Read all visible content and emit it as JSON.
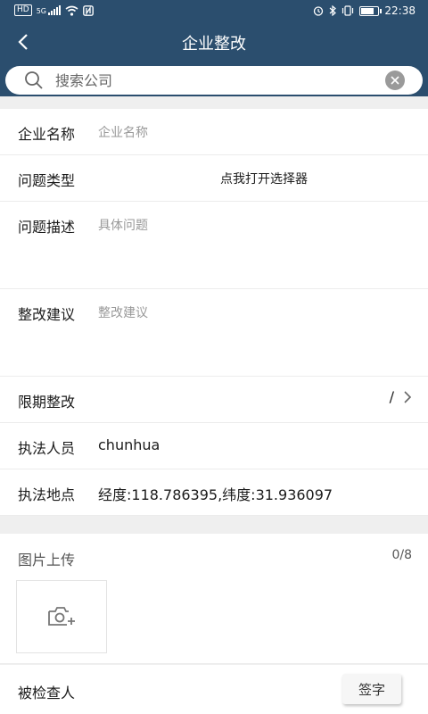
{
  "status": {
    "time": "22:38",
    "left_icons": [
      "hd-badge",
      "signal-5g-icon",
      "wifi-icon",
      "nfc-icon"
    ],
    "hd_label": "HD",
    "net_label": "5G",
    "battery_fraction": 0.7
  },
  "nav": {
    "title": "企业整改"
  },
  "search": {
    "placeholder": "搜索公司"
  },
  "form": {
    "company": {
      "label": "企业名称",
      "placeholder": "企业名称"
    },
    "issue_type": {
      "label": "问题类型",
      "value": "点我打开选择器"
    },
    "issue_desc": {
      "label": "问题描述",
      "placeholder": "具体问题"
    },
    "suggestion": {
      "label": "整改建议",
      "placeholder": "整改建议"
    },
    "deadline": {
      "label": "限期整改",
      "value": "/"
    },
    "officer": {
      "label": "执法人员",
      "value": "chunhua"
    },
    "location": {
      "label": "执法地点",
      "value": "经度:118.786395,纬度:31.936097"
    }
  },
  "upload": {
    "label": "图片上传",
    "count": "0/8"
  },
  "inspected": {
    "label": "被检查人",
    "sign_label": "签字"
  },
  "colors": {
    "header": "#2b4e6e",
    "background": "#efefef"
  }
}
